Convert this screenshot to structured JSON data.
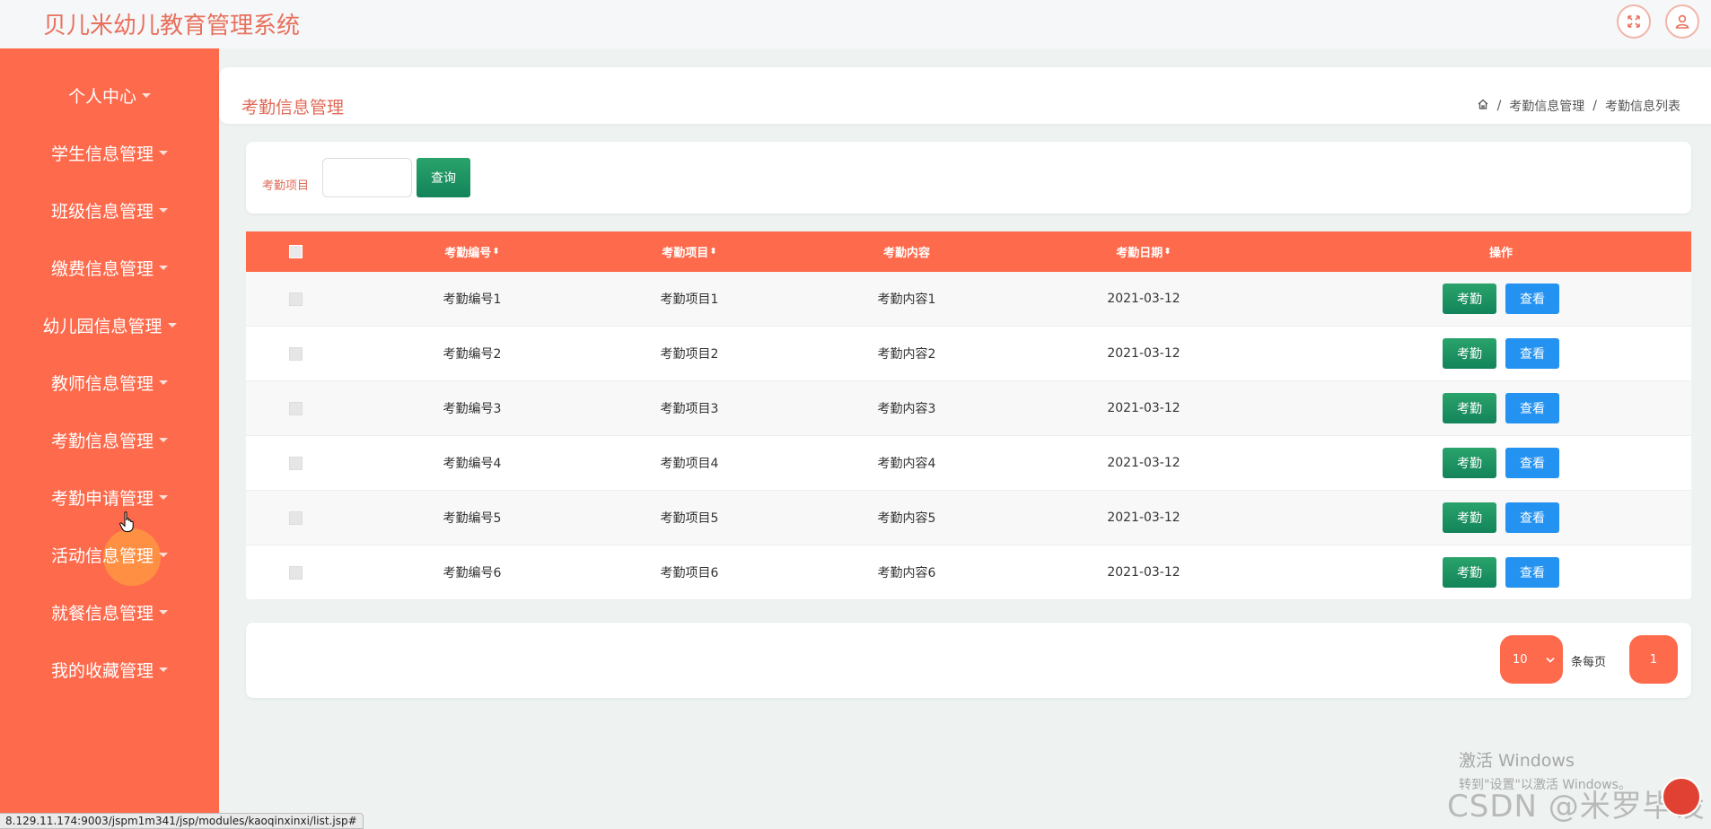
{
  "app_title": "贝儿米幼儿教育管理系统",
  "top_icons": [
    "fullscreen-icon",
    "user-icon"
  ],
  "sidebar": {
    "items": [
      {
        "label": "个人中心"
      },
      {
        "label": "学生信息管理"
      },
      {
        "label": "班级信息管理"
      },
      {
        "label": "缴费信息管理"
      },
      {
        "label": "幼儿园信息管理"
      },
      {
        "label": "教师信息管理"
      },
      {
        "label": "考勤信息管理"
      },
      {
        "label": "考勤申请管理"
      },
      {
        "label": "活动信息管理"
      },
      {
        "label": "就餐信息管理"
      },
      {
        "label": "我的收藏管理"
      }
    ]
  },
  "header": {
    "title": "考勤信息管理",
    "breadcrumb": [
      "考勤信息管理",
      "考勤信息列表"
    ],
    "breadcrumb_sep": "/"
  },
  "search": {
    "label": "考勤项目",
    "value": "",
    "button": "查询"
  },
  "table": {
    "columns": [
      "考勤编号",
      "考勤项目",
      "考勤内容",
      "考勤日期",
      "操作"
    ],
    "sortable": [
      true,
      true,
      false,
      true,
      false
    ],
    "sort_glyph": "⬍",
    "rows": [
      {
        "code": "考勤编号1",
        "item": "考勤项目1",
        "content": "考勤内容1",
        "date": "2021-03-12"
      },
      {
        "code": "考勤编号2",
        "item": "考勤项目2",
        "content": "考勤内容2",
        "date": "2021-03-12"
      },
      {
        "code": "考勤编号3",
        "item": "考勤项目3",
        "content": "考勤内容3",
        "date": "2021-03-12"
      },
      {
        "code": "考勤编号4",
        "item": "考勤项目4",
        "content": "考勤内容4",
        "date": "2021-03-12"
      },
      {
        "code": "考勤编号5",
        "item": "考勤项目5",
        "content": "考勤内容5",
        "date": "2021-03-12"
      },
      {
        "code": "考勤编号6",
        "item": "考勤项目6",
        "content": "考勤内容6",
        "date": "2021-03-12"
      }
    ],
    "action_primary": "考勤",
    "action_secondary": "查看"
  },
  "pagination": {
    "page_size": "10",
    "page_size_label": "条每页",
    "current_page": "1"
  },
  "status_url": "8.129.11.174:9003/jspm1m341/jsp/modules/kaoqinxinxi/list.jsp#",
  "watermark": {
    "windows_title": "激活 Windows",
    "windows_sub": "转到\"设置\"以激活 Windows。",
    "csdn": "CSDN @米罗毕设"
  },
  "colors": {
    "accent": "#fe6a4c",
    "title": "#e8715d",
    "green_button": "#13845a",
    "blue_button": "#2492f0"
  }
}
